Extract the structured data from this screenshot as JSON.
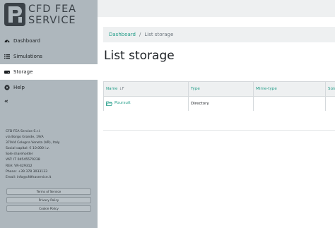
{
  "brand": {
    "line1": "CFD FEA",
    "line2": "SERVICE"
  },
  "sidebar": {
    "items": [
      {
        "label": "Dashboard",
        "icon": "dashboard-icon"
      },
      {
        "label": "Simulations",
        "icon": "list-icon"
      },
      {
        "label": "Storage",
        "icon": "storage-icon",
        "active": true
      },
      {
        "label": "Help",
        "icon": "help-icon"
      }
    ],
    "collapse_label": "«",
    "company_lines": [
      "CFD FEA Service S.r.l.",
      "via Borgo Grande, 19/A",
      "37044 Cologna Veneta (VR), Italy",
      "Social capital: € 10.000 i.v.",
      "Sole shareholder",
      "VAT: IT 04545570238",
      "REA: VR-429312",
      "Phone: +39 378 3033133",
      "Email: info@cfdfeaservice.it"
    ],
    "policies": [
      "Terms of Service",
      "Privacy Policy",
      "Cookie Policy"
    ]
  },
  "breadcrumb": {
    "home": "Dashboard",
    "separator": "/",
    "current": "List storage"
  },
  "page": {
    "title": "List storage"
  },
  "table": {
    "headers": {
      "name": "Name",
      "sort_icon": "↓F",
      "type": "Type",
      "mime": "Mime-type",
      "size": "Size"
    },
    "rows": [
      {
        "name": "Poursuit",
        "type": "Directory",
        "mime": "",
        "size": ""
      }
    ]
  },
  "colors": {
    "accent": "#1e9b86",
    "sidebar": "#aeb7bd"
  }
}
